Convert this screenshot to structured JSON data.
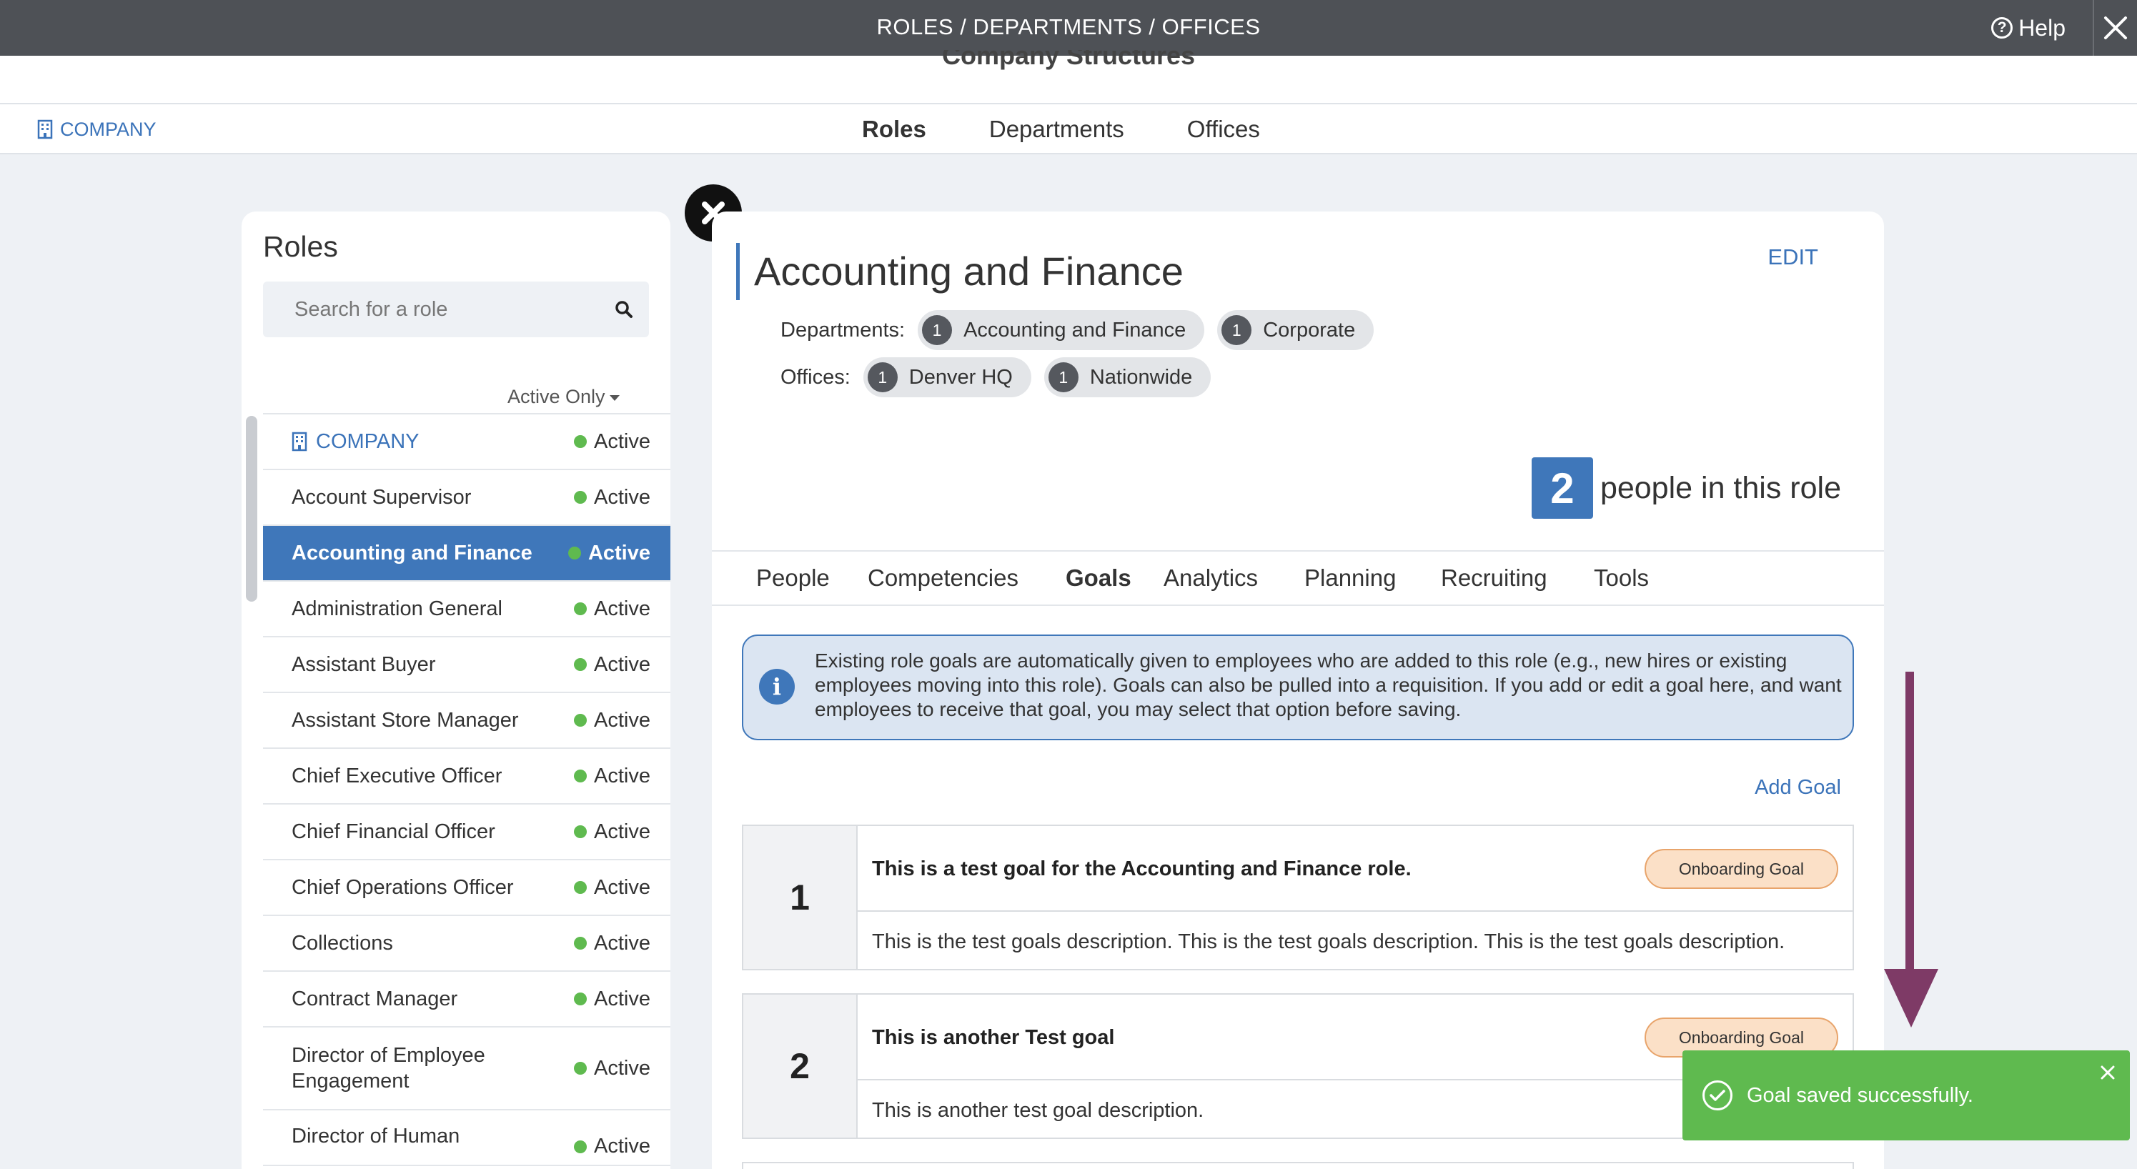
{
  "header": {
    "title": "ROLES / DEPARTMENTS / OFFICES",
    "subtitle": "Company Structures",
    "help_label": "Help"
  },
  "subnav": {
    "company_label": "COMPANY",
    "tabs": [
      {
        "label": "Roles",
        "active": true
      },
      {
        "label": "Departments",
        "active": false
      },
      {
        "label": "Offices",
        "active": false
      }
    ]
  },
  "sidebar": {
    "title": "Roles",
    "search_placeholder": "Search for a role",
    "filter_label": "Active Only",
    "roles": [
      {
        "name": "COMPANY",
        "status": "Active"
      },
      {
        "name": "Account Supervisor",
        "status": "Active"
      },
      {
        "name": "Accounting and Finance",
        "status": "Active"
      },
      {
        "name": "Administration General",
        "status": "Active"
      },
      {
        "name": "Assistant Buyer",
        "status": "Active"
      },
      {
        "name": "Assistant Store Manager",
        "status": "Active"
      },
      {
        "name": "Chief Executive Officer",
        "status": "Active"
      },
      {
        "name": "Chief Financial Officer",
        "status": "Active"
      },
      {
        "name": "Chief Operations Officer",
        "status": "Active"
      },
      {
        "name": "Collections",
        "status": "Active"
      },
      {
        "name": "Contract Manager",
        "status": "Active"
      },
      {
        "name": "Director of Employee Engagement",
        "status": "Active"
      },
      {
        "name": "Director of Human",
        "status": "Active"
      }
    ]
  },
  "detail": {
    "title": "Accounting and Finance",
    "edit_label": "EDIT",
    "departments_label": "Departments:",
    "departments": [
      {
        "count": "1",
        "name": "Accounting and Finance"
      },
      {
        "count": "1",
        "name": "Corporate"
      }
    ],
    "offices_label": "Offices:",
    "offices": [
      {
        "count": "1",
        "name": "Denver HQ"
      },
      {
        "count": "1",
        "name": "Nationwide"
      }
    ],
    "people_count": "2",
    "people_label": "people in this role",
    "tabs": [
      "People",
      "Competencies",
      "Goals",
      "Analytics",
      "Planning",
      "Recruiting",
      "Tools"
    ],
    "active_tab": "Goals",
    "info_text": "Existing role goals are automatically given to employees who are added to this role (e.g., new hires or existing employees moving into this role). Goals can also be pulled into a requisition. If you add or edit a goal here, and want employees to receive that goal, you may select that option before saving.",
    "add_goal_label": "Add Goal",
    "goals": [
      {
        "number": "1",
        "title": "This is a test goal for the Accounting and Finance role.",
        "badge": "Onboarding Goal",
        "description": "This is the test goals description. This is the test goals description. This is the test goals description."
      },
      {
        "number": "2",
        "title": "This is another Test goal",
        "badge": "Onboarding Goal",
        "description": "This is another test goal description."
      }
    ]
  },
  "toast": {
    "message": "Goal saved successfully.",
    "color": "#5fba4f"
  },
  "colors": {
    "accent": "#3f77ba",
    "header_bg": "#4e5156",
    "status_active": "#5fba4f",
    "annotation_arrow": "#7e3a66"
  }
}
